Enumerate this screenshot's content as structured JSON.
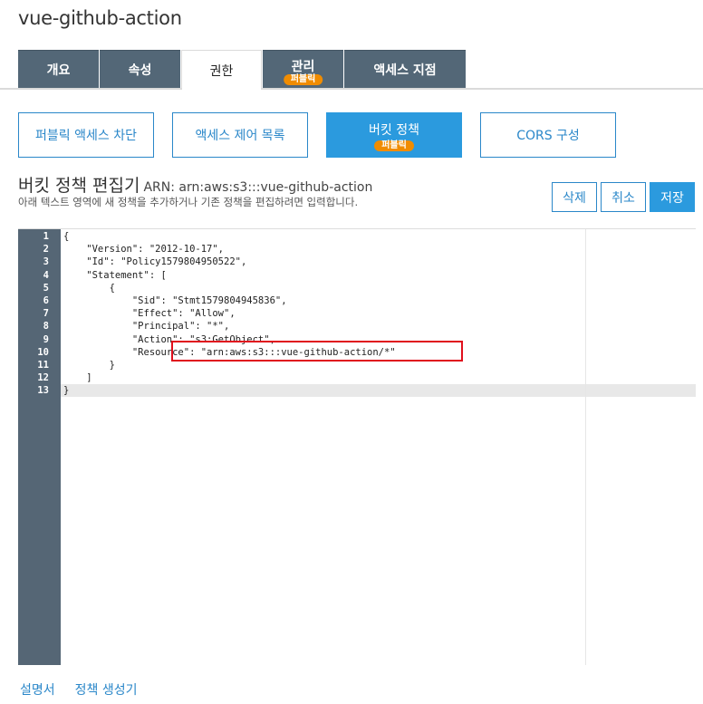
{
  "bucket": {
    "name": "vue-github-action"
  },
  "tabs": [
    {
      "label": "개요",
      "badge": ""
    },
    {
      "label": "속성",
      "badge": ""
    },
    {
      "label": "권한",
      "badge": ""
    },
    {
      "label": "관리",
      "badge": "퍼블릭"
    },
    {
      "label": "액세스 지점",
      "badge": ""
    }
  ],
  "subtabs": [
    {
      "label": "퍼블릭 액세스 차단",
      "badge": ""
    },
    {
      "label": "액세스 제어 목록",
      "badge": ""
    },
    {
      "label": "버킷 정책",
      "badge": "퍼블릭"
    },
    {
      "label": "CORS 구성",
      "badge": ""
    }
  ],
  "editor": {
    "title": "버킷 정책 편집기",
    "arn": "ARN: arn:aws:s3:::vue-github-action",
    "description": "아래 텍스트 영역에 새 정책을 추가하거나 기존 정책을 편집하려면 입력합니다.",
    "buttons": {
      "delete": "삭제",
      "cancel": "취소",
      "save": "저장"
    },
    "line_numbers": [
      "1",
      "2",
      "3",
      "4",
      "5",
      "6",
      "7",
      "8",
      "9",
      "10",
      "11",
      "12",
      "13"
    ],
    "lines": [
      "{",
      "    \"Version\": \"2012-10-17\",",
      "    \"Id\": \"Policy1579804950522\",",
      "    \"Statement\": [",
      "        {",
      "            \"Sid\": \"Stmt1579804945836\",",
      "            \"Effect\": \"Allow\",",
      "            \"Principal\": \"*\",",
      "            \"Action\": \"s3:GetObject\",",
      "            \"Resource\": \"arn:aws:s3:::vue-github-action/*\"",
      "        }",
      "    ]",
      "}"
    ]
  },
  "footer": {
    "docs": "설명서",
    "policy_generator": "정책 생성기"
  },
  "colors": {
    "tab_bg": "#536777",
    "accent": "#2b9ade",
    "badge": "#f08c00",
    "highlight": "#e0101d",
    "gutter": "#556675"
  }
}
